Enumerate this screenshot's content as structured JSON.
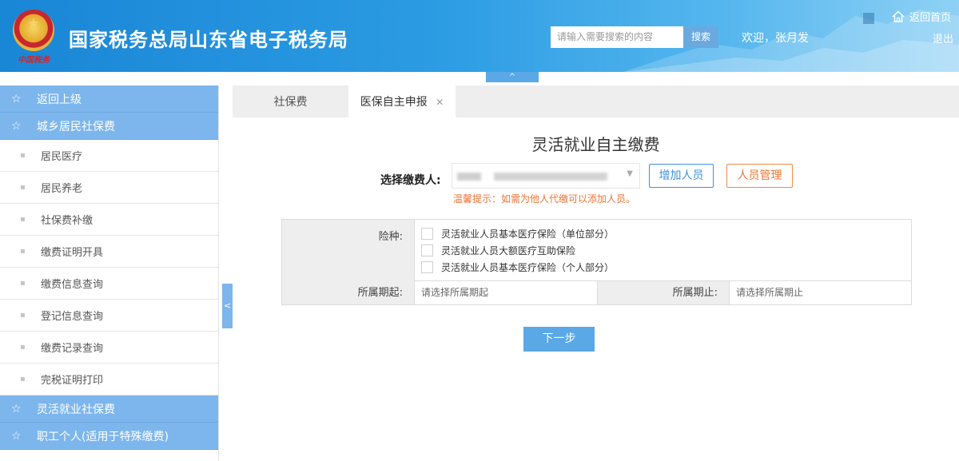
{
  "header": {
    "site_title": "国家税务总局山东省电子税务局",
    "brand_sign": "中国税务",
    "search_placeholder": "请输入需要搜索的内容",
    "search_button": "搜索",
    "welcome_text": "欢迎，张月发",
    "home_link": "返回首页",
    "logout": "退出",
    "collapse_glyph": "^"
  },
  "sidebar": {
    "back": "返回上级",
    "groups": [
      {
        "label": "城乡居民社保费"
      },
      {
        "label": "灵活就业社保费"
      },
      {
        "label": "职工个人(适用于特殊缴费)"
      }
    ],
    "items": [
      {
        "label": "居民医疗"
      },
      {
        "label": "居民养老"
      },
      {
        "label": "社保费补缴"
      },
      {
        "label": "缴费证明开具"
      },
      {
        "label": "缴费信息查询"
      },
      {
        "label": "登记信息查询"
      },
      {
        "label": "缴费记录查询"
      },
      {
        "label": "完税证明打印"
      }
    ],
    "toggle_glyph": "<"
  },
  "tabs": [
    {
      "label": "社保费",
      "active": false
    },
    {
      "label": "医保自主申报",
      "active": true,
      "closable": true
    }
  ],
  "form": {
    "title": "灵活就业自主缴费",
    "payer_label": "选择缴费人:",
    "add_person": "增加人员",
    "manage_persons": "人员管理",
    "hint": "温馨提示：如需为他人代缴可以添加人员。",
    "insurance_label": "险种:",
    "insurance_options": [
      {
        "label": "灵活就业人员基本医疗保险（单位部分）",
        "checked": false
      },
      {
        "label": "灵活就业人员大额医疗互助保险",
        "checked": false
      },
      {
        "label": "灵活就业人员基本医疗保险（个人部分）",
        "checked": false
      }
    ],
    "period_start_label": "所属期起:",
    "period_start_placeholder": "请选择所属期起",
    "period_end_label": "所属期止:",
    "period_end_placeholder": "请选择所属期止",
    "next_button": "下一步"
  },
  "colors": {
    "header_blue": "#1a86d6",
    "sidebar_head": "#7cb6ec",
    "primary_button": "#5aa8e6",
    "warning_orange": "#f07434"
  }
}
